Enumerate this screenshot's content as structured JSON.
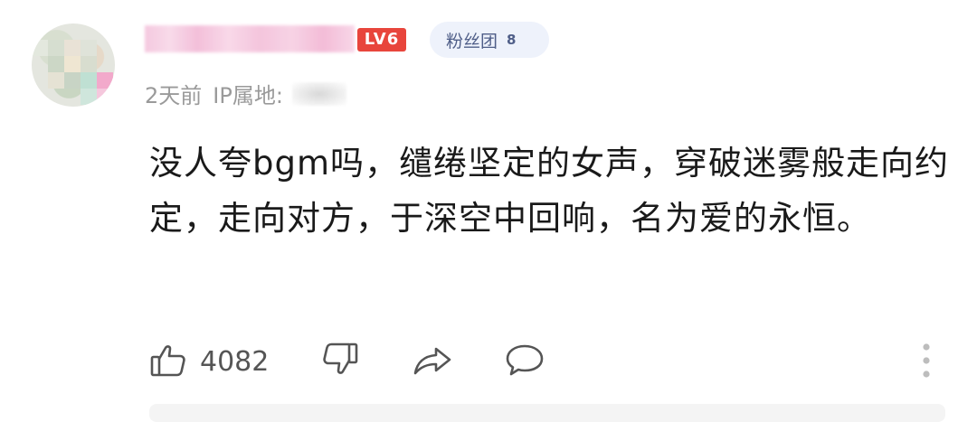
{
  "comment": {
    "level_badge": "LV6",
    "fan_badge": {
      "label": "粉丝团",
      "level": "8"
    },
    "time_ago": "2天前",
    "ip_label": "IP属地:",
    "text": "没人夸bgm吗，缱绻坚定的女声，穿破迷雾般走向约定，走向对方，于深空中回响，名为爱的永恒。",
    "like_count": "4082",
    "icons": {
      "like": "thumbs-up-icon",
      "dislike": "thumbs-down-icon",
      "share": "share-icon",
      "reply": "comment-bubble-icon",
      "more": "more-vertical-icon"
    },
    "colors": {
      "level_badge": "#e8453c",
      "fan_badge_bg": "#eef2fb",
      "fan_badge_text": "#4f5e88",
      "meta_text": "#9a9a9a"
    }
  }
}
